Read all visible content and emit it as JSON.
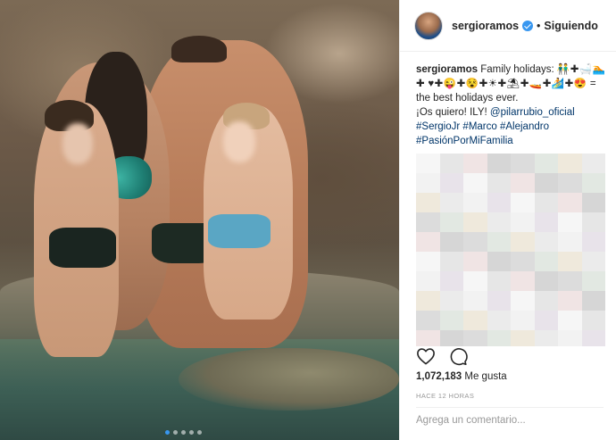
{
  "post": {
    "username": "sergioramos",
    "separator": "•",
    "follow_status": "Siguiendo",
    "caption": {
      "author": "sergioramos",
      "text_1": "Family holidays:",
      "emoji_1": "👬✚🛁🏊✚",
      "emoji_2": "♥✚😜✚😵✚☀✚⛱✚🚤✚🏄✚😍",
      "text_2": "= the best holidays ever.",
      "text_3": "¡Os quiero! ILY!",
      "mention": "@pilarrubio_oficial",
      "hashtag_1": "#SergioJr",
      "hashtag_2": "#Marco",
      "hashtag_3": "#Alejandro",
      "hashtag_4": "#PasiónPorMiFamilia"
    },
    "likes_count": "1,072,183",
    "likes_label": "Me gusta",
    "timestamp": "HACE 12 HORAS",
    "comment_placeholder": "Agrega un comentario..."
  },
  "icons": {
    "like": "heart-icon",
    "comment": "comment-bubble-icon",
    "verified": "verified-badge-icon"
  },
  "colors": {
    "link": "#003569",
    "verified": "#3897f0",
    "muted": "#999999",
    "text": "#262626"
  },
  "carousel": {
    "total": 5,
    "active_index": 0
  }
}
